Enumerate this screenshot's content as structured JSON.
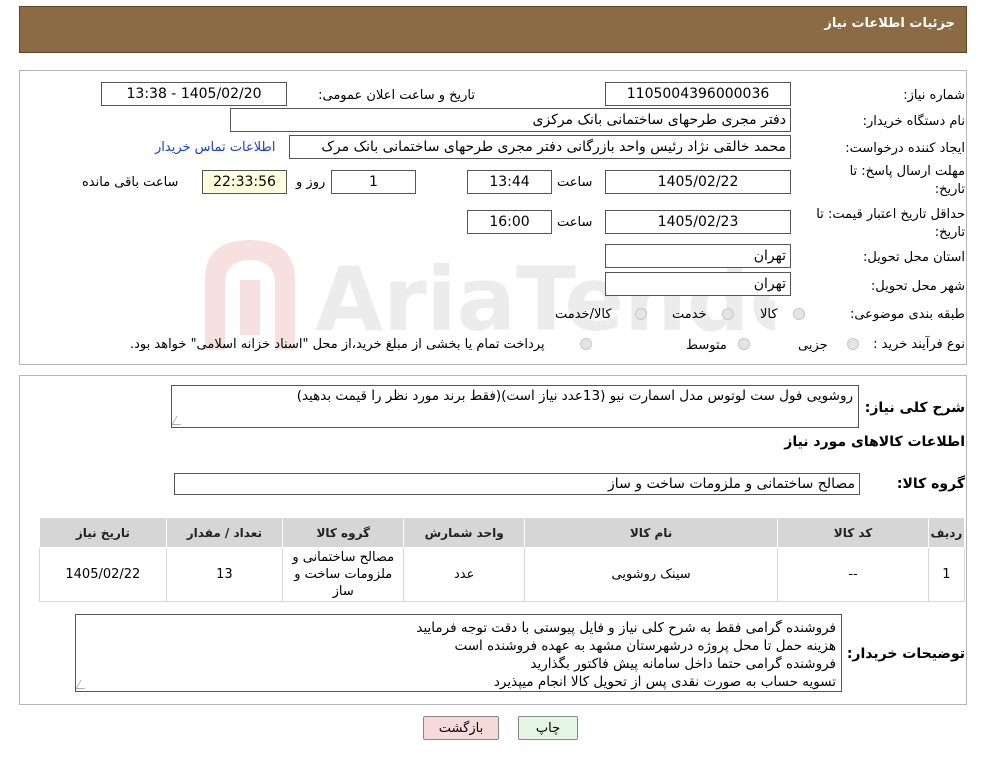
{
  "header": {
    "title": "جزئیات اطلاعات نیاز"
  },
  "form": {
    "need_number": {
      "label": "شماره نیاز:",
      "value": "1105004396000036"
    },
    "announce_datetime": {
      "label": "تاریخ و ساعت اعلان عمومی:",
      "value": "1405/02/20 - 13:38"
    },
    "buyer_org": {
      "label": "نام دستگاه خریدار:",
      "value": "دفتر مجری طرحهای ساختمانی بانک مرکزی"
    },
    "requester": {
      "label": "ایجاد کننده درخواست:",
      "value": "محمد خالقی نژاد رئیس واحد بازرگانی دفتر مجری طرحهای ساختمانی بانک مرک",
      "link": "اطلاعات تماس خریدار"
    },
    "reply_deadline": {
      "label_line1": "مهلت ارسال پاسخ: تا",
      "label_line2": "تاریخ:",
      "date": "1405/02/22",
      "time_label": "ساعت",
      "time": "13:44",
      "days": "1",
      "days_label": "روز و",
      "remaining": "22:33:56",
      "remaining_label": "ساعت باقی مانده"
    },
    "price_validity": {
      "label_line1": "حداقل تاریخ اعتبار قیمت: تا",
      "label_line2": "تاریخ:",
      "date": "1405/02/23",
      "time_label": "ساعت",
      "time": "16:00"
    },
    "delivery_province": {
      "label": "استان محل تحویل:",
      "value": "تهران"
    },
    "delivery_city": {
      "label": "شهر محل تحویل:",
      "value": "تهران"
    },
    "category": {
      "label": "طبقه بندی موضوعی:",
      "options": [
        "کالا",
        "خدمت",
        "کالا/خدمت"
      ]
    },
    "purchase_type": {
      "label": "نوع فرآیند خرید :",
      "options": [
        "جزیی",
        "متوسط"
      ],
      "note": "پرداخت تمام یا بخشی از مبلغ خرید،از محل \"اسناد خزانه اسلامی\" خواهد بود."
    }
  },
  "description": {
    "label": "شرح کلی نیاز:",
    "value": "روشویی فول ست لوتوس مدل اسمارت نیو (13عدد نیاز است)(فقط برند مورد نظر را قیمت بدهید)"
  },
  "goods_section": {
    "title": "اطلاعات کالاهای مورد نیاز",
    "group_label": "گروه کالا:",
    "group_value": "مصالح ساختمانی و ملزومات ساخت و ساز"
  },
  "table": {
    "headers": [
      "ردیف",
      "کد کالا",
      "نام کالا",
      "واحد شمارش",
      "گروه کالا",
      "تعداد / مقدار",
      "تاریخ نیاز"
    ],
    "rows": [
      [
        "1",
        "--",
        "سینک روشویی",
        "عدد",
        "مصالح ساختمانی و ملزومات ساخت و ساز",
        "13",
        "1405/02/22"
      ]
    ]
  },
  "buyer_notes": {
    "label": "توضیحات خریدار:",
    "lines": [
      "فروشنده گرامی فقط به شرح کلی نیاز و فایل پیوستی با دقت توجه فرمایید",
      "هزینه حمل تا محل پروژه درشهرستان مشهد به عهده فروشنده است",
      "فروشنده گرامی حتما داخل سامانه پیش فاکتور بگذارید",
      "تسویه حساب به صورت نقدی پس از تحویل کالا  انجام میپذیرد"
    ]
  },
  "buttons": {
    "print": "چاپ",
    "back": "بازگشت"
  },
  "colors": {
    "header_bg": "#8b6a44",
    "back_button_bg": "#f7d9d9",
    "print_button_bg": "#e4f5e4"
  }
}
